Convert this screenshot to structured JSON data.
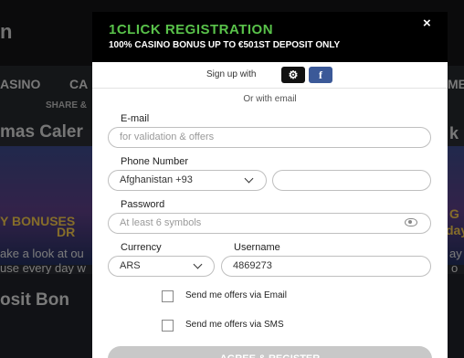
{
  "background": {
    "logo_fragment": "n",
    "nav_items": [
      "ASINO",
      "CA",
      "ME"
    ],
    "share_label": "SHARE &",
    "page_title_fragment": "mas Caler",
    "page_title_right": "k",
    "banner_line1": "Y BONUSES",
    "banner_line2": "DR",
    "banner_right1": "G",
    "banner_right2": "day",
    "desc_line1": "ake a look at ou",
    "desc_line2": "use every day w",
    "desc_right1": "ay",
    "desc_right2": "o",
    "deposit_title": "osit Bon"
  },
  "modal": {
    "title": "1CLICK REGISTRATION",
    "subtitle": "100% CASINO BONUS UP TO €501ST DEPOSIT ONLY",
    "close_icon": "×",
    "signup_label": "Sign up with",
    "social": {
      "steam_glyph": "⚙",
      "facebook_glyph": "f"
    },
    "or_email": "Or with email",
    "email": {
      "label": "E-mail",
      "placeholder": "for validation & offers"
    },
    "phone": {
      "label": "Phone Number",
      "country": "Afghanistan +93",
      "value": ""
    },
    "password": {
      "label": "Password",
      "placeholder": "At least 6 symbols"
    },
    "currency": {
      "label": "Currency",
      "value": "ARS"
    },
    "username": {
      "label": "Username",
      "value": "4869273"
    },
    "checkbox_email": "Send me offers via Email",
    "checkbox_sms": "Send me offers via SMS",
    "submit_label": "AGREE & REGISTER",
    "colors": {
      "title_green": "#59c24a",
      "facebook": "#3b5998",
      "header_bg": "#000000"
    }
  }
}
